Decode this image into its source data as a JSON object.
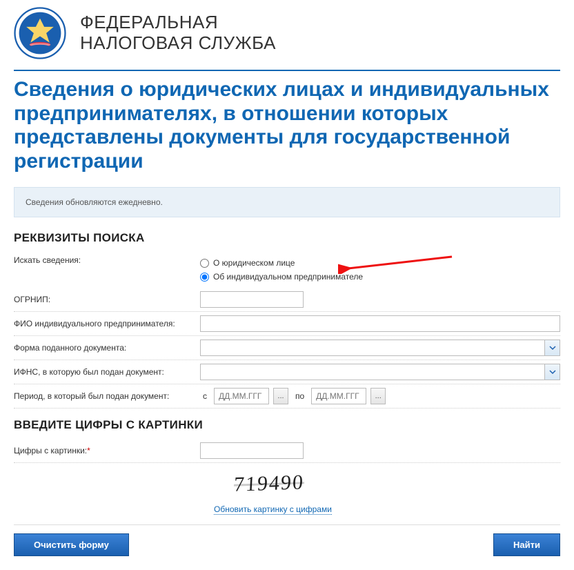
{
  "header": {
    "org_line1": "ФЕДЕРАЛЬНАЯ",
    "org_line2": "НАЛОГОВАЯ СЛУЖБА"
  },
  "page_title": "Сведения о юридических лицах и индивидуальных предпринимателях, в отношении которых представлены документы для государственной регистрации",
  "notice": "Сведения обновляются ежедневно.",
  "sections": {
    "search_params": "РЕКВИЗИТЫ ПОИСКА",
    "captcha": "ВВЕДИТЕ ЦИФРЫ С КАРТИНКИ"
  },
  "labels": {
    "search_for": "Искать сведения:",
    "ogrnip": "ОГРНИП:",
    "fio": "ФИО индивидуального предпринимателя:",
    "doc_form": "Форма поданного документа:",
    "ifns": "ИФНС, в которую был подан документ:",
    "period": "Период, в который был подан документ:",
    "captcha_digits": "Цифры с картинки:"
  },
  "radios": {
    "legal": "О юридическом лице",
    "ip": "Об индивидуальном предпринимателе"
  },
  "period": {
    "from": "с",
    "to": "по",
    "placeholder": "ДД.ММ.ГГГ",
    "btn": "..."
  },
  "captcha": {
    "value": "719490",
    "refresh": "Обновить картинку с цифрами"
  },
  "required_mark": "*",
  "buttons": {
    "clear": "Очистить форму",
    "search": "Найти"
  }
}
